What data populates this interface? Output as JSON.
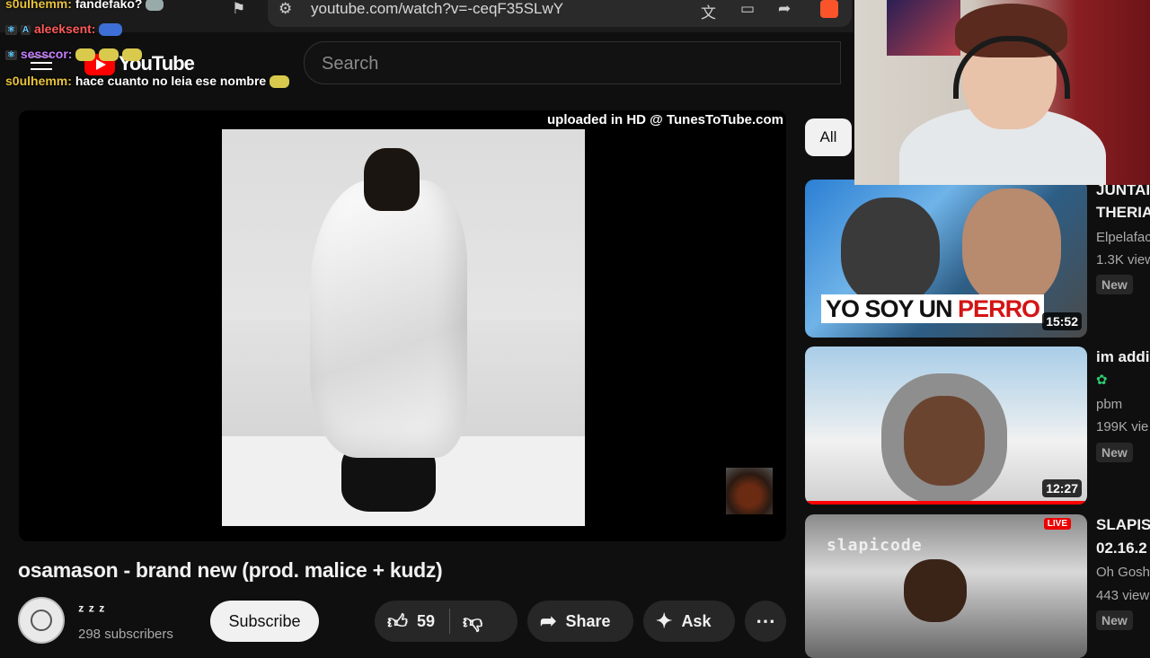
{
  "browser": {
    "url": "youtube.com/watch?v=-ceqF35SLwY"
  },
  "header": {
    "logo_text": "YouTube",
    "search_placeholder": "Search"
  },
  "chat": [
    {
      "user": "s0ulhemm:",
      "message": "fandefako?"
    },
    {
      "user": "aleeksent:",
      "message": ""
    },
    {
      "user": "sesscor:",
      "message": ""
    },
    {
      "user": "s0ulhemm:",
      "message": "hace cuanto no leia ese nombre"
    }
  ],
  "player": {
    "overlay_text": "uploaded in HD @ TunesToTube.com"
  },
  "video": {
    "title": "osamason - brand new (prod. malice + kudz)",
    "channel_name": "ᶻ ᶻ ᶻ",
    "subscribers": "298 subscribers",
    "subscribe_label": "Subscribe",
    "likes": "59",
    "share_label": "Share",
    "ask_label": "Ask"
  },
  "sidebar": {
    "chip_all": "All",
    "items": [
      {
        "title": "JUNTAI",
        "title2": "THERIA",
        "channel": "Elpelafac",
        "views": "1.3K view",
        "badge": "New",
        "duration": "15:52",
        "thumb_text_a": "YO SOY UN ",
        "thumb_text_b": "PERRO"
      },
      {
        "title": "im addi",
        "channel": "pbm",
        "views": "199K vie",
        "badge": "New",
        "duration": "12:27"
      },
      {
        "title": "SLAPIS",
        "title2": "02.16.2",
        "channel": "Oh Gosh",
        "views": "443 view",
        "badge": "New",
        "thumb_text": "slapicode",
        "live_badge": "LIVE"
      }
    ]
  },
  "colors": {
    "background": "#0f0f0f",
    "youtube_red": "#ff0000",
    "chat_username": "#e8c33a"
  }
}
